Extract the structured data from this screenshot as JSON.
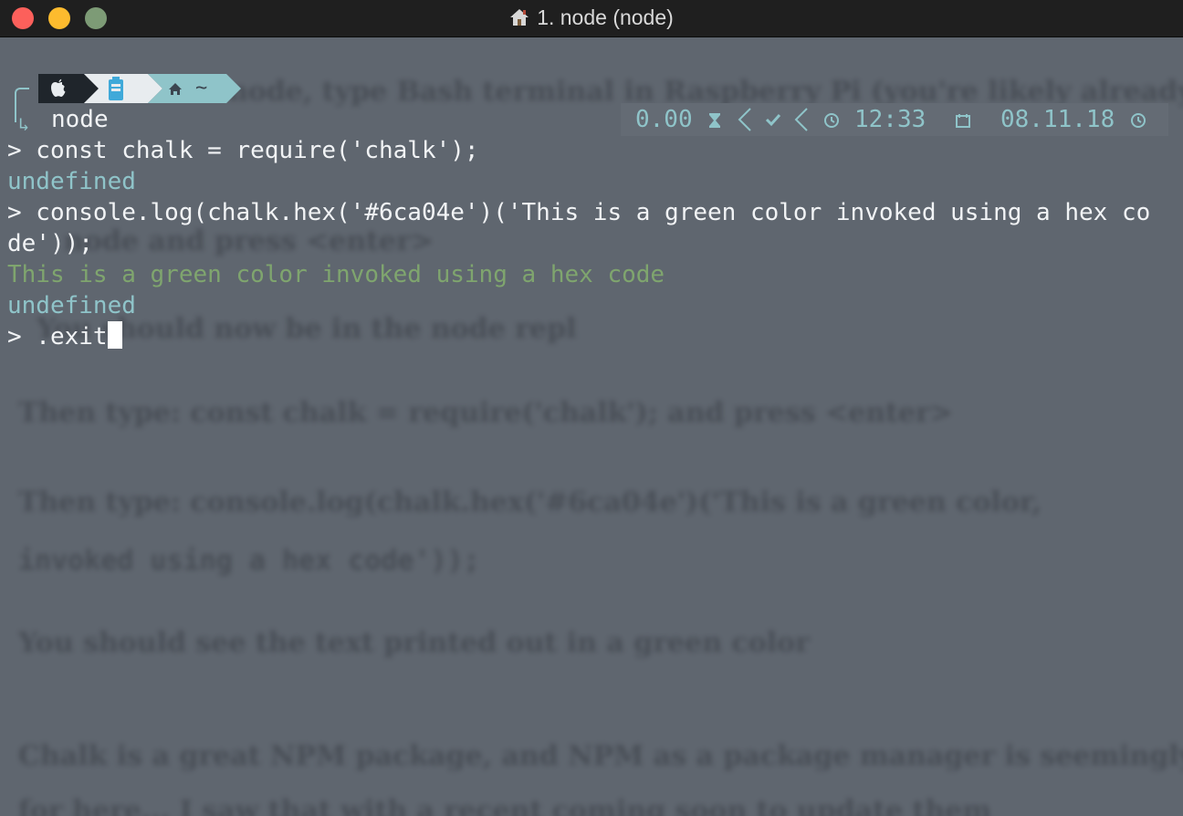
{
  "window": {
    "title": "1. node (node)"
  },
  "prompt": {
    "segment_icons": [
      "apple-icon",
      "battery-icon",
      "home-icon"
    ],
    "dir": "~",
    "context": "node"
  },
  "right_prompt": {
    "load": "0.00",
    "time": "12:33",
    "date": "08.11.18"
  },
  "lines": [
    {
      "text": "> const chalk = require('chalk');",
      "kind": "input"
    },
    {
      "text": "undefined",
      "kind": "result"
    },
    {
      "text": "> console.log(chalk.hex('#6ca04e')('This is a green color invoked using a hex co",
      "kind": "input"
    },
    {
      "text": "de'));",
      "kind": "input"
    },
    {
      "text": "This is a green color invoked using a hex code",
      "kind": "green"
    },
    {
      "text": "undefined",
      "kind": "result"
    },
    {
      "text": "> .exit",
      "kind": "input"
    }
  ],
  "background_article": [
    "node, type Bash terminal in Raspberry Pi (you're likely already",
    "node and press <enter>",
    "You should now be in the node repl",
    "Then type: const chalk = require('chalk'); and press <enter>",
    "Then type: console.log(chalk.hex('#6ca04e')('This is a green color,",
    "invoked using a hex code'));",
    "You should see the text printed out in a green color",
    "Chalk is a great NPM package, and NPM as a package manager is seemingly",
    "for here... I saw that with a recent coming soon to update them"
  ],
  "colors": {
    "terminal_bg": "#5f666f",
    "text": "#f1f3f5",
    "result": "#8fc4c9",
    "green_output": "#6ca04e"
  }
}
